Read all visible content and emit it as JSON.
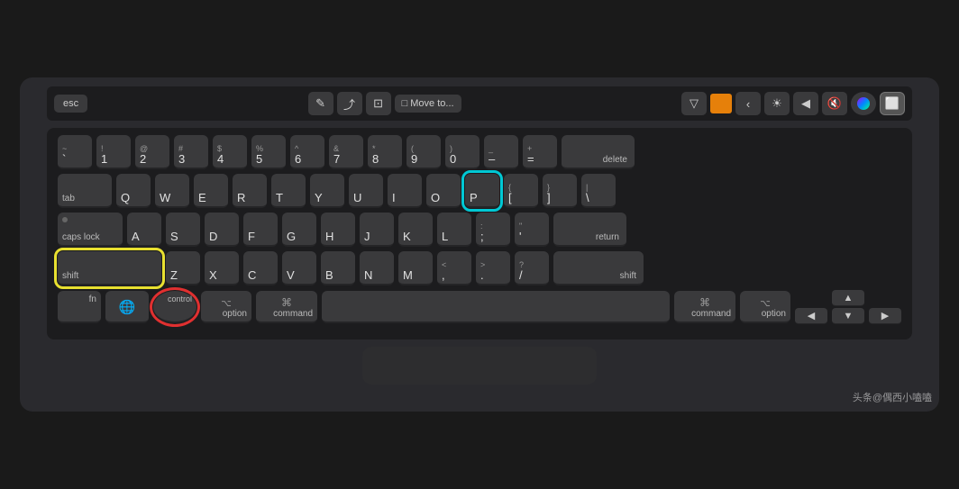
{
  "touchbar": {
    "esc": "esc",
    "icon1": "✎",
    "icon2": "⤴",
    "icon3": "⊡",
    "move_to": "Move to...",
    "icon4_arrow": "▼",
    "siri_label": "Siri",
    "brightness": "☀",
    "volume": "◀",
    "mute": "🔇"
  },
  "rows": {
    "row1": {
      "keys": [
        {
          "top": "~",
          "main": "`"
        },
        {
          "top": "!",
          "main": "1"
        },
        {
          "top": "@",
          "main": "2"
        },
        {
          "top": "#",
          "main": "3"
        },
        {
          "top": "$",
          "main": "4"
        },
        {
          "top": "%",
          "main": "5"
        },
        {
          "top": "^",
          "main": "6"
        },
        {
          "top": "&",
          "main": "7"
        },
        {
          "top": "*",
          "main": "8"
        },
        {
          "top": "(",
          "main": "9"
        },
        {
          "top": ")",
          "main": "0"
        },
        {
          "top": "_",
          "main": "–"
        },
        {
          "top": "+",
          "main": "="
        },
        {
          "main": "delete",
          "wide": true
        }
      ]
    }
  },
  "watermark": "头条@偶西小嗑嗑"
}
